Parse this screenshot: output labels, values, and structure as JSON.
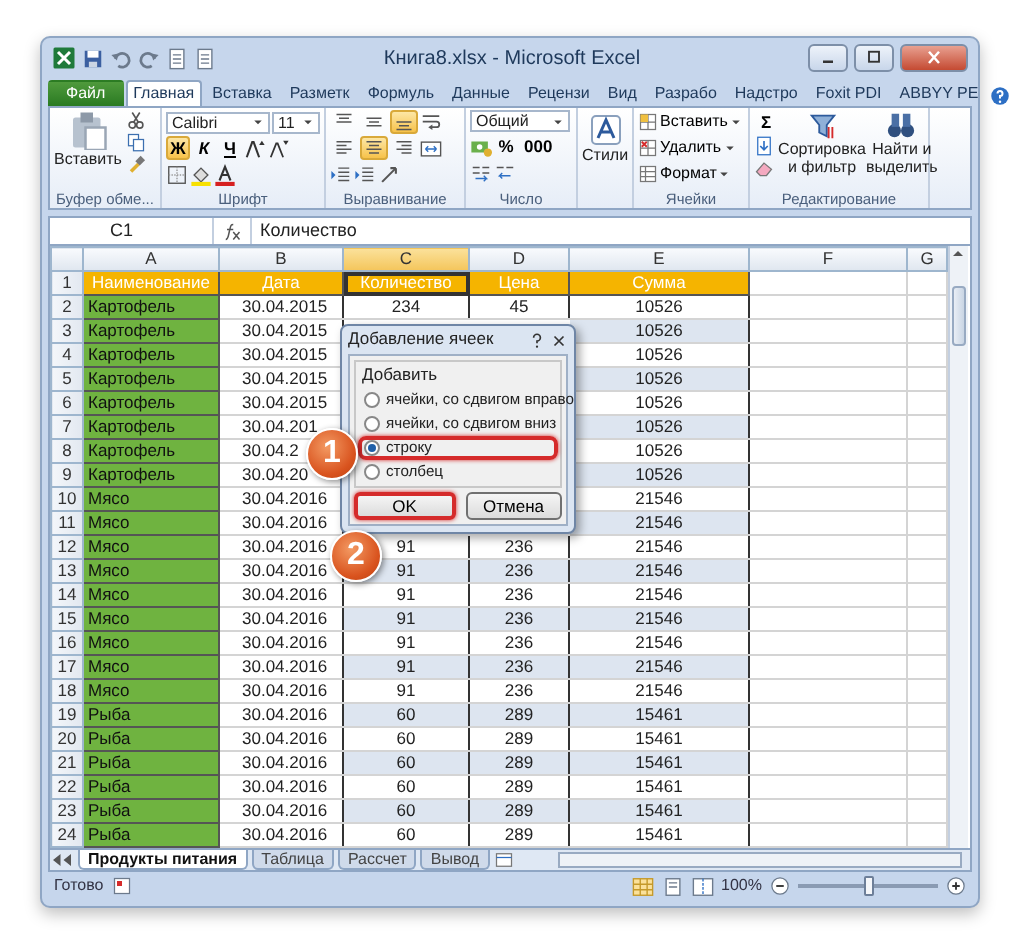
{
  "window": {
    "title": "Книга8.xlsx - Microsoft Excel"
  },
  "ribbon_tabs": [
    {
      "label": "Файл",
      "kind": "file",
      "selected": false
    },
    {
      "label": "Главная",
      "kind": "tab",
      "selected": true
    },
    {
      "label": "Вставка",
      "kind": "tab",
      "selected": false
    },
    {
      "label": "Разметк",
      "kind": "tab",
      "selected": false
    },
    {
      "label": "Формуль",
      "kind": "tab",
      "selected": false
    },
    {
      "label": "Данные",
      "kind": "tab",
      "selected": false
    },
    {
      "label": "Рецензи",
      "kind": "tab",
      "selected": false
    },
    {
      "label": "Вид",
      "kind": "tab",
      "selected": false
    },
    {
      "label": "Разрабо",
      "kind": "tab",
      "selected": false
    },
    {
      "label": "Надстро",
      "kind": "tab",
      "selected": false
    },
    {
      "label": "Foxit PDI",
      "kind": "tab",
      "selected": false
    },
    {
      "label": "ABBYY PE",
      "kind": "tab",
      "selected": false
    }
  ],
  "ribbon": {
    "clipboard": {
      "paste_label": "Вставить",
      "group_label": "Буфер обме..."
    },
    "font": {
      "name": "Calibri",
      "size": "11",
      "styles": [
        {
          "label": "Ж",
          "selected": true
        },
        {
          "label": "К",
          "selected": false
        },
        {
          "label": "Ч",
          "selected": false
        }
      ],
      "group_label": "Шрифт"
    },
    "alignment": {
      "buttons": [
        {
          "kind": "top",
          "selected": false
        },
        {
          "kind": "middle",
          "selected": false
        },
        {
          "kind": "bottom",
          "selected": true
        },
        {
          "kind": "left",
          "selected": false
        },
        {
          "kind": "center",
          "selected": true
        },
        {
          "kind": "right",
          "selected": false
        }
      ],
      "group_label": "Выравнивание"
    },
    "number": {
      "format": "Общий",
      "percent": "%",
      "thousands": "000",
      "group_label": "Число"
    },
    "styles": {
      "label": "Стили"
    },
    "cells": {
      "buttons": [
        "Вставить",
        "Удалить",
        "Формат"
      ],
      "group_label": "Ячейки"
    },
    "editing": {
      "sum": "Σ",
      "sort": "Сортировка и фильтр",
      "find": "Найти и выделить",
      "group_label": "Редактирование"
    }
  },
  "formula_bar": {
    "name_box": "C1",
    "formula": "Количество"
  },
  "columns": [
    {
      "label": "A",
      "selected": false
    },
    {
      "label": "B",
      "selected": false
    },
    {
      "label": "C",
      "selected": true
    },
    {
      "label": "D",
      "selected": false
    },
    {
      "label": "E",
      "selected": false
    },
    {
      "label": "F",
      "selected": false
    },
    {
      "label": "G",
      "selected": false
    }
  ],
  "rows": [
    {
      "number": "1",
      "kind": "header",
      "cells": [
        "Наименование",
        "Дата",
        "Количество",
        "Цена",
        "Сумма"
      ]
    },
    {
      "number": "2",
      "kind": "data",
      "cells": [
        "Картофель",
        "30.04.2015",
        "234",
        "45",
        "10526"
      ]
    },
    {
      "number": "3",
      "kind": "data",
      "cells": [
        "Картофель",
        "30.04.2015",
        null,
        null,
        "10526"
      ]
    },
    {
      "number": "4",
      "kind": "data",
      "cells": [
        "Картофель",
        "30.04.2015",
        null,
        null,
        "10526"
      ]
    },
    {
      "number": "5",
      "kind": "data",
      "cells": [
        "Картофель",
        "30.04.2015",
        null,
        null,
        "10526"
      ]
    },
    {
      "number": "6",
      "kind": "data",
      "cells": [
        "Картофель",
        "30.04.2015",
        null,
        null,
        "10526"
      ]
    },
    {
      "number": "7",
      "kind": "data",
      "cells": [
        "Картофель",
        "30.04.201",
        null,
        null,
        "10526"
      ]
    },
    {
      "number": "8",
      "kind": "data",
      "cells": [
        "Картофель",
        "30.04.2",
        null,
        null,
        "10526"
      ]
    },
    {
      "number": "9",
      "kind": "data",
      "cells": [
        "Картофель",
        "30.04.20",
        null,
        null,
        "10526"
      ]
    },
    {
      "number": "10",
      "kind": "data",
      "cells": [
        "Мясо",
        "30.04.2016",
        null,
        null,
        "21546"
      ]
    },
    {
      "number": "11",
      "kind": "data",
      "cells": [
        "Мясо",
        "30.04.2016",
        null,
        null,
        "21546"
      ]
    },
    {
      "number": "12",
      "kind": "data",
      "cells": [
        "Мясо",
        "30.04.2016",
        "91",
        "236",
        "21546"
      ]
    },
    {
      "number": "13",
      "kind": "data",
      "cells": [
        "Мясо",
        "30.04.2016",
        "91",
        "236",
        "21546"
      ]
    },
    {
      "number": "14",
      "kind": "data",
      "cells": [
        "Мясо",
        "30.04.2016",
        "91",
        "236",
        "21546"
      ]
    },
    {
      "number": "15",
      "kind": "data",
      "cells": [
        "Мясо",
        "30.04.2016",
        "91",
        "236",
        "21546"
      ]
    },
    {
      "number": "16",
      "kind": "data",
      "cells": [
        "Мясо",
        "30.04.2016",
        "91",
        "236",
        "21546"
      ]
    },
    {
      "number": "17",
      "kind": "data",
      "cells": [
        "Мясо",
        "30.04.2016",
        "91",
        "236",
        "21546"
      ]
    },
    {
      "number": "18",
      "kind": "data",
      "cells": [
        "Мясо",
        "30.04.2016",
        "91",
        "236",
        "21546"
      ]
    },
    {
      "number": "19",
      "kind": "data",
      "cells": [
        "Рыба",
        "30.04.2016",
        "60",
        "289",
        "15461"
      ]
    },
    {
      "number": "20",
      "kind": "data",
      "cells": [
        "Рыба",
        "30.04.2016",
        "60",
        "289",
        "15461"
      ]
    },
    {
      "number": "21",
      "kind": "data",
      "cells": [
        "Рыба",
        "30.04.2016",
        "60",
        "289",
        "15461"
      ]
    },
    {
      "number": "22",
      "kind": "data",
      "cells": [
        "Рыба",
        "30.04.2016",
        "60",
        "289",
        "15461"
      ]
    },
    {
      "number": "23",
      "kind": "data",
      "cells": [
        "Рыба",
        "30.04.2016",
        "60",
        "289",
        "15461"
      ]
    },
    {
      "number": "24",
      "kind": "data",
      "cells": [
        "Рыба",
        "30.04.2016",
        "60",
        "289",
        "15461"
      ]
    }
  ],
  "dialog": {
    "title": "Добавление ячеек",
    "group_label": "Добавить",
    "options": [
      {
        "label": "ячейки, со сдвигом вправо",
        "selected": false,
        "highlighted": false
      },
      {
        "label": "ячейки, со сдвигом вниз",
        "selected": false,
        "highlighted": false
      },
      {
        "label": "строку",
        "selected": true,
        "highlighted": true
      },
      {
        "label": "столбец",
        "selected": false,
        "highlighted": false
      }
    ],
    "buttons": [
      {
        "label": "OK",
        "highlighted": true
      },
      {
        "label": "Отмена",
        "highlighted": false
      }
    ]
  },
  "callouts": [
    {
      "label": "1"
    },
    {
      "label": "2"
    }
  ],
  "sheet_tabs": [
    {
      "label": "Продукты питания",
      "selected": true
    },
    {
      "label": "Таблица",
      "selected": false
    },
    {
      "label": "Рассчет",
      "selected": false
    },
    {
      "label": "Вывод",
      "selected": false
    }
  ],
  "status_bar": {
    "status": "Готово",
    "zoom": "100%",
    "zoom_slider": {
      "level": 0.5
    }
  }
}
